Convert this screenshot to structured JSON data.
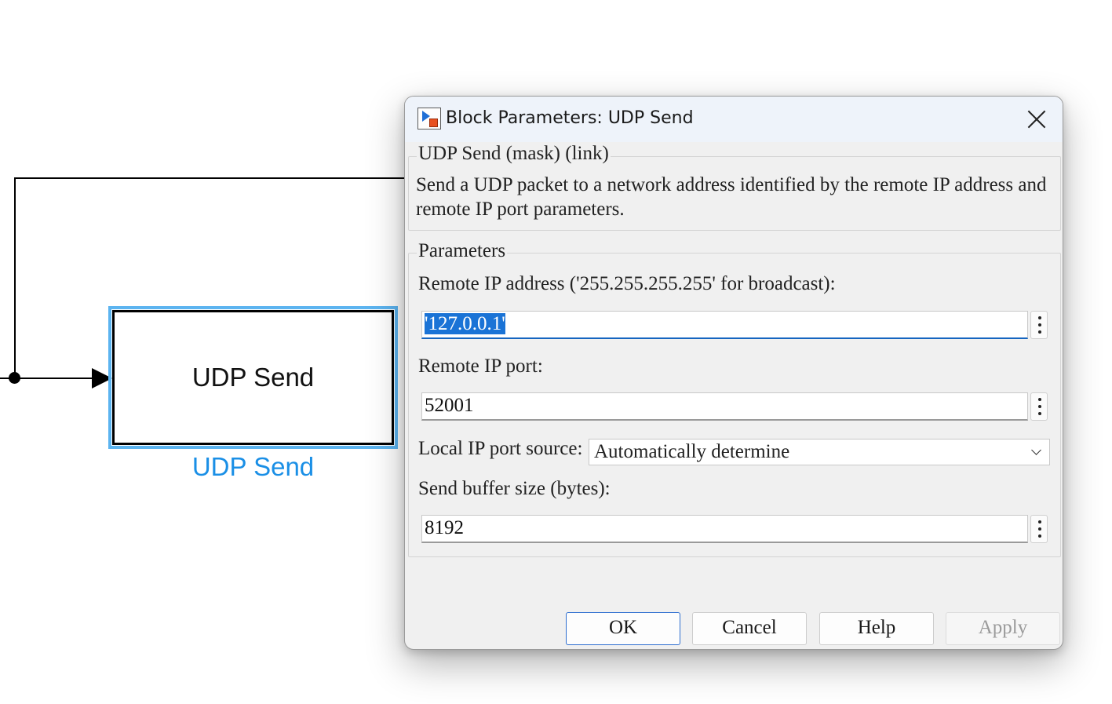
{
  "canvas": {
    "block_name": "UDP Send",
    "block_label": "UDP Send"
  },
  "dialog": {
    "title": "Block Parameters: UDP Send",
    "mask_header": "UDP Send (mask) (link)",
    "description": "Send a UDP packet to a network address identified by the remote IP address and remote IP port parameters.",
    "params_header": "Parameters",
    "remote_ip": {
      "label": "Remote IP address ('255.255.255.255' for broadcast):",
      "value": "'127.0.0.1'"
    },
    "remote_port": {
      "label": "Remote IP port:",
      "value": "52001"
    },
    "local_port_source": {
      "label": "Local IP port source:",
      "value": "Automatically determine"
    },
    "buffer_size": {
      "label": "Send buffer size (bytes):",
      "value": "8192"
    },
    "buttons": {
      "ok": "OK",
      "cancel": "Cancel",
      "help": "Help",
      "apply": "Apply"
    }
  },
  "colors": {
    "selection_highlight": "#5cb4f0",
    "block_label": "#1a8fe6",
    "text_selection": "#1a73d6",
    "primary_button_border": "#2f6fd0"
  }
}
